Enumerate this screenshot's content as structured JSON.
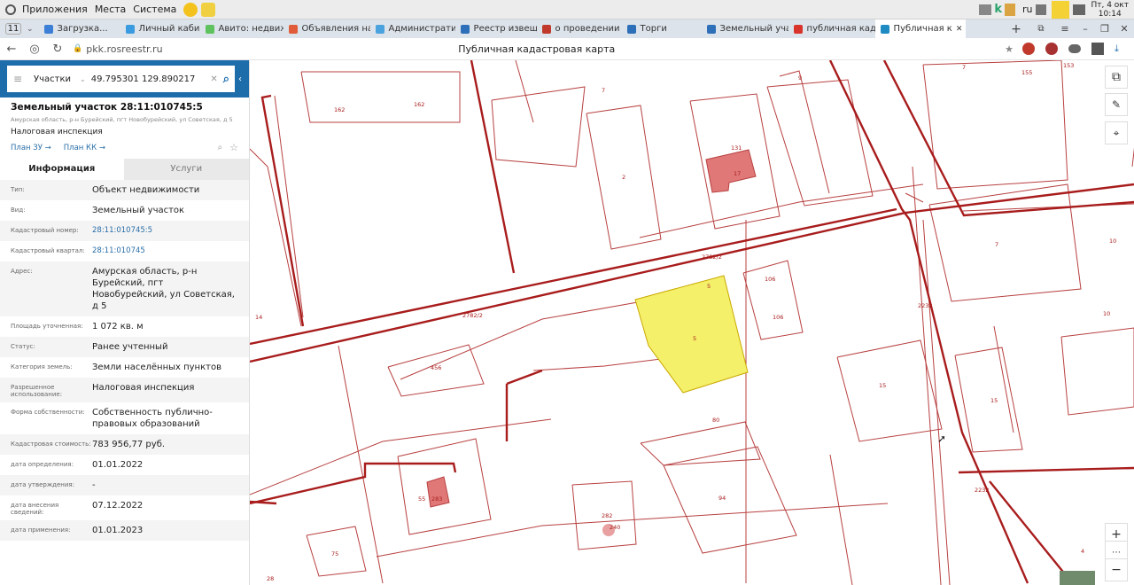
{
  "os_menu": {
    "items": [
      "Приложения",
      "Места",
      "Система"
    ],
    "lang": "ru",
    "clock_date": "Пт, 4 окт",
    "clock_time": "10:14"
  },
  "tabs": [
    {
      "label": "Загрузка...",
      "color": "#3b7fd6"
    },
    {
      "label": "Личный кабине",
      "color": "#3a9be0"
    },
    {
      "label": "Авито: недвиж",
      "color": "#5ec35e"
    },
    {
      "label": "Объявления на",
      "color": "#e05c3a"
    },
    {
      "label": "Административ",
      "color": "#4aa3df"
    },
    {
      "label": "Реестр извеще",
      "color": "#2d6fb8"
    },
    {
      "label": "о проведении т",
      "color": "#c0392b"
    },
    {
      "label": "Торги",
      "color": "#2d6fb8"
    },
    {
      "label": "Земельный уча",
      "color": "#2d6fb8"
    },
    {
      "label": "публичная кад",
      "color": "#d9342b"
    },
    {
      "label": "Публичная к",
      "color": "#1e8bc3",
      "active": true
    }
  ],
  "tab_counter": "11",
  "address": {
    "url": "pkk.rosreestr.ru",
    "page_title": "Публичная кадастровая карта"
  },
  "search": {
    "type": "Участки",
    "query": "49.795301 129.890217"
  },
  "parcel": {
    "title": "Земельный участок 28:11:010745:5",
    "address_small": "Амурская область, р-н Бурейский, пгт Новобурейский, ул Советская, д 5",
    "name": "Налоговая инспекция",
    "plan_zu": "План ЗУ →",
    "plan_kk": "План КК →"
  },
  "info_tabs": {
    "info": "Информация",
    "services": "Услуги"
  },
  "fields": [
    {
      "k": "Тип:",
      "v": "Объект недвижимости"
    },
    {
      "k": "Вид:",
      "v": "Земельный участок"
    },
    {
      "k": "Кадастровый номер:",
      "v": "28:11:010745:5",
      "link": true
    },
    {
      "k": "Кадастровый квартал:",
      "v": "28:11:010745",
      "link": true
    },
    {
      "k": "Адрес:",
      "v": "Амурская область, р-н Бурейский, пгт Новобурейский, ул Советская, д 5"
    },
    {
      "k": "Площадь уточненная:",
      "v": "1 072 кв. м"
    },
    {
      "k": "Статус:",
      "v": "Ранее учтенный"
    },
    {
      "k": "Категория земель:",
      "v": "Земли населённых пунктов"
    },
    {
      "k": "Разрешенное использование:",
      "v": "Налоговая инспекция"
    },
    {
      "k": "Форма собственности:",
      "v": "Собственность публично-правовых образований"
    },
    {
      "k": "Кадастровая стоимость:",
      "v": "783 956,77 руб."
    },
    {
      "k": "дата определения:",
      "v": "01.01.2022"
    },
    {
      "k": "дата утверждения:",
      "v": "-"
    },
    {
      "k": "дата внесения сведений:",
      "v": "07.12.2022"
    },
    {
      "k": "дата применения:",
      "v": "01.01.2023"
    }
  ],
  "map_labels": [
    "162",
    "162",
    "7",
    "9",
    "7",
    "155",
    "153",
    "131",
    "2",
    "10",
    "2782/2",
    "106",
    "106",
    "5",
    "5",
    "14",
    "2782/2",
    "7",
    "2232",
    "10",
    "456",
    "15",
    "15",
    "80",
    "55",
    "283",
    "282",
    "94",
    "75",
    "28",
    "4",
    "2232",
    "240",
    "17"
  ],
  "colors": {
    "accent": "#1e6dab",
    "parcel_line": "#a81c1c",
    "selected": "#f5f06a"
  }
}
